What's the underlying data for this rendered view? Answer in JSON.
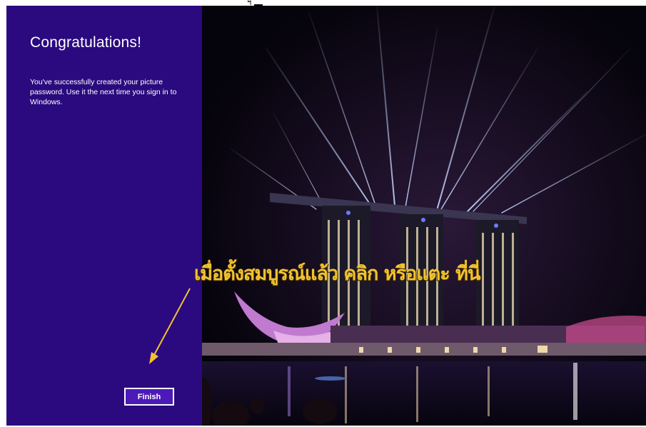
{
  "top_marker": {
    "glyph": "ฯ"
  },
  "left_panel": {
    "title": "Congratulations!",
    "description": "You've successfully created your picture password. Use it the next time you sign in to Windows.",
    "finish_label": "Finish"
  },
  "annotation": {
    "text": "เมื่อตั้งสมบูรณ์แล้ว คลิก หรือแตะ ที่นี่"
  },
  "colors": {
    "panel": "#2b0a7f",
    "button_fill": "#4c1ab8",
    "annotation_text": "#f2c230",
    "arrow": "#f2c230"
  },
  "background_image": {
    "icon": "night-skyline-light-show-photo"
  }
}
